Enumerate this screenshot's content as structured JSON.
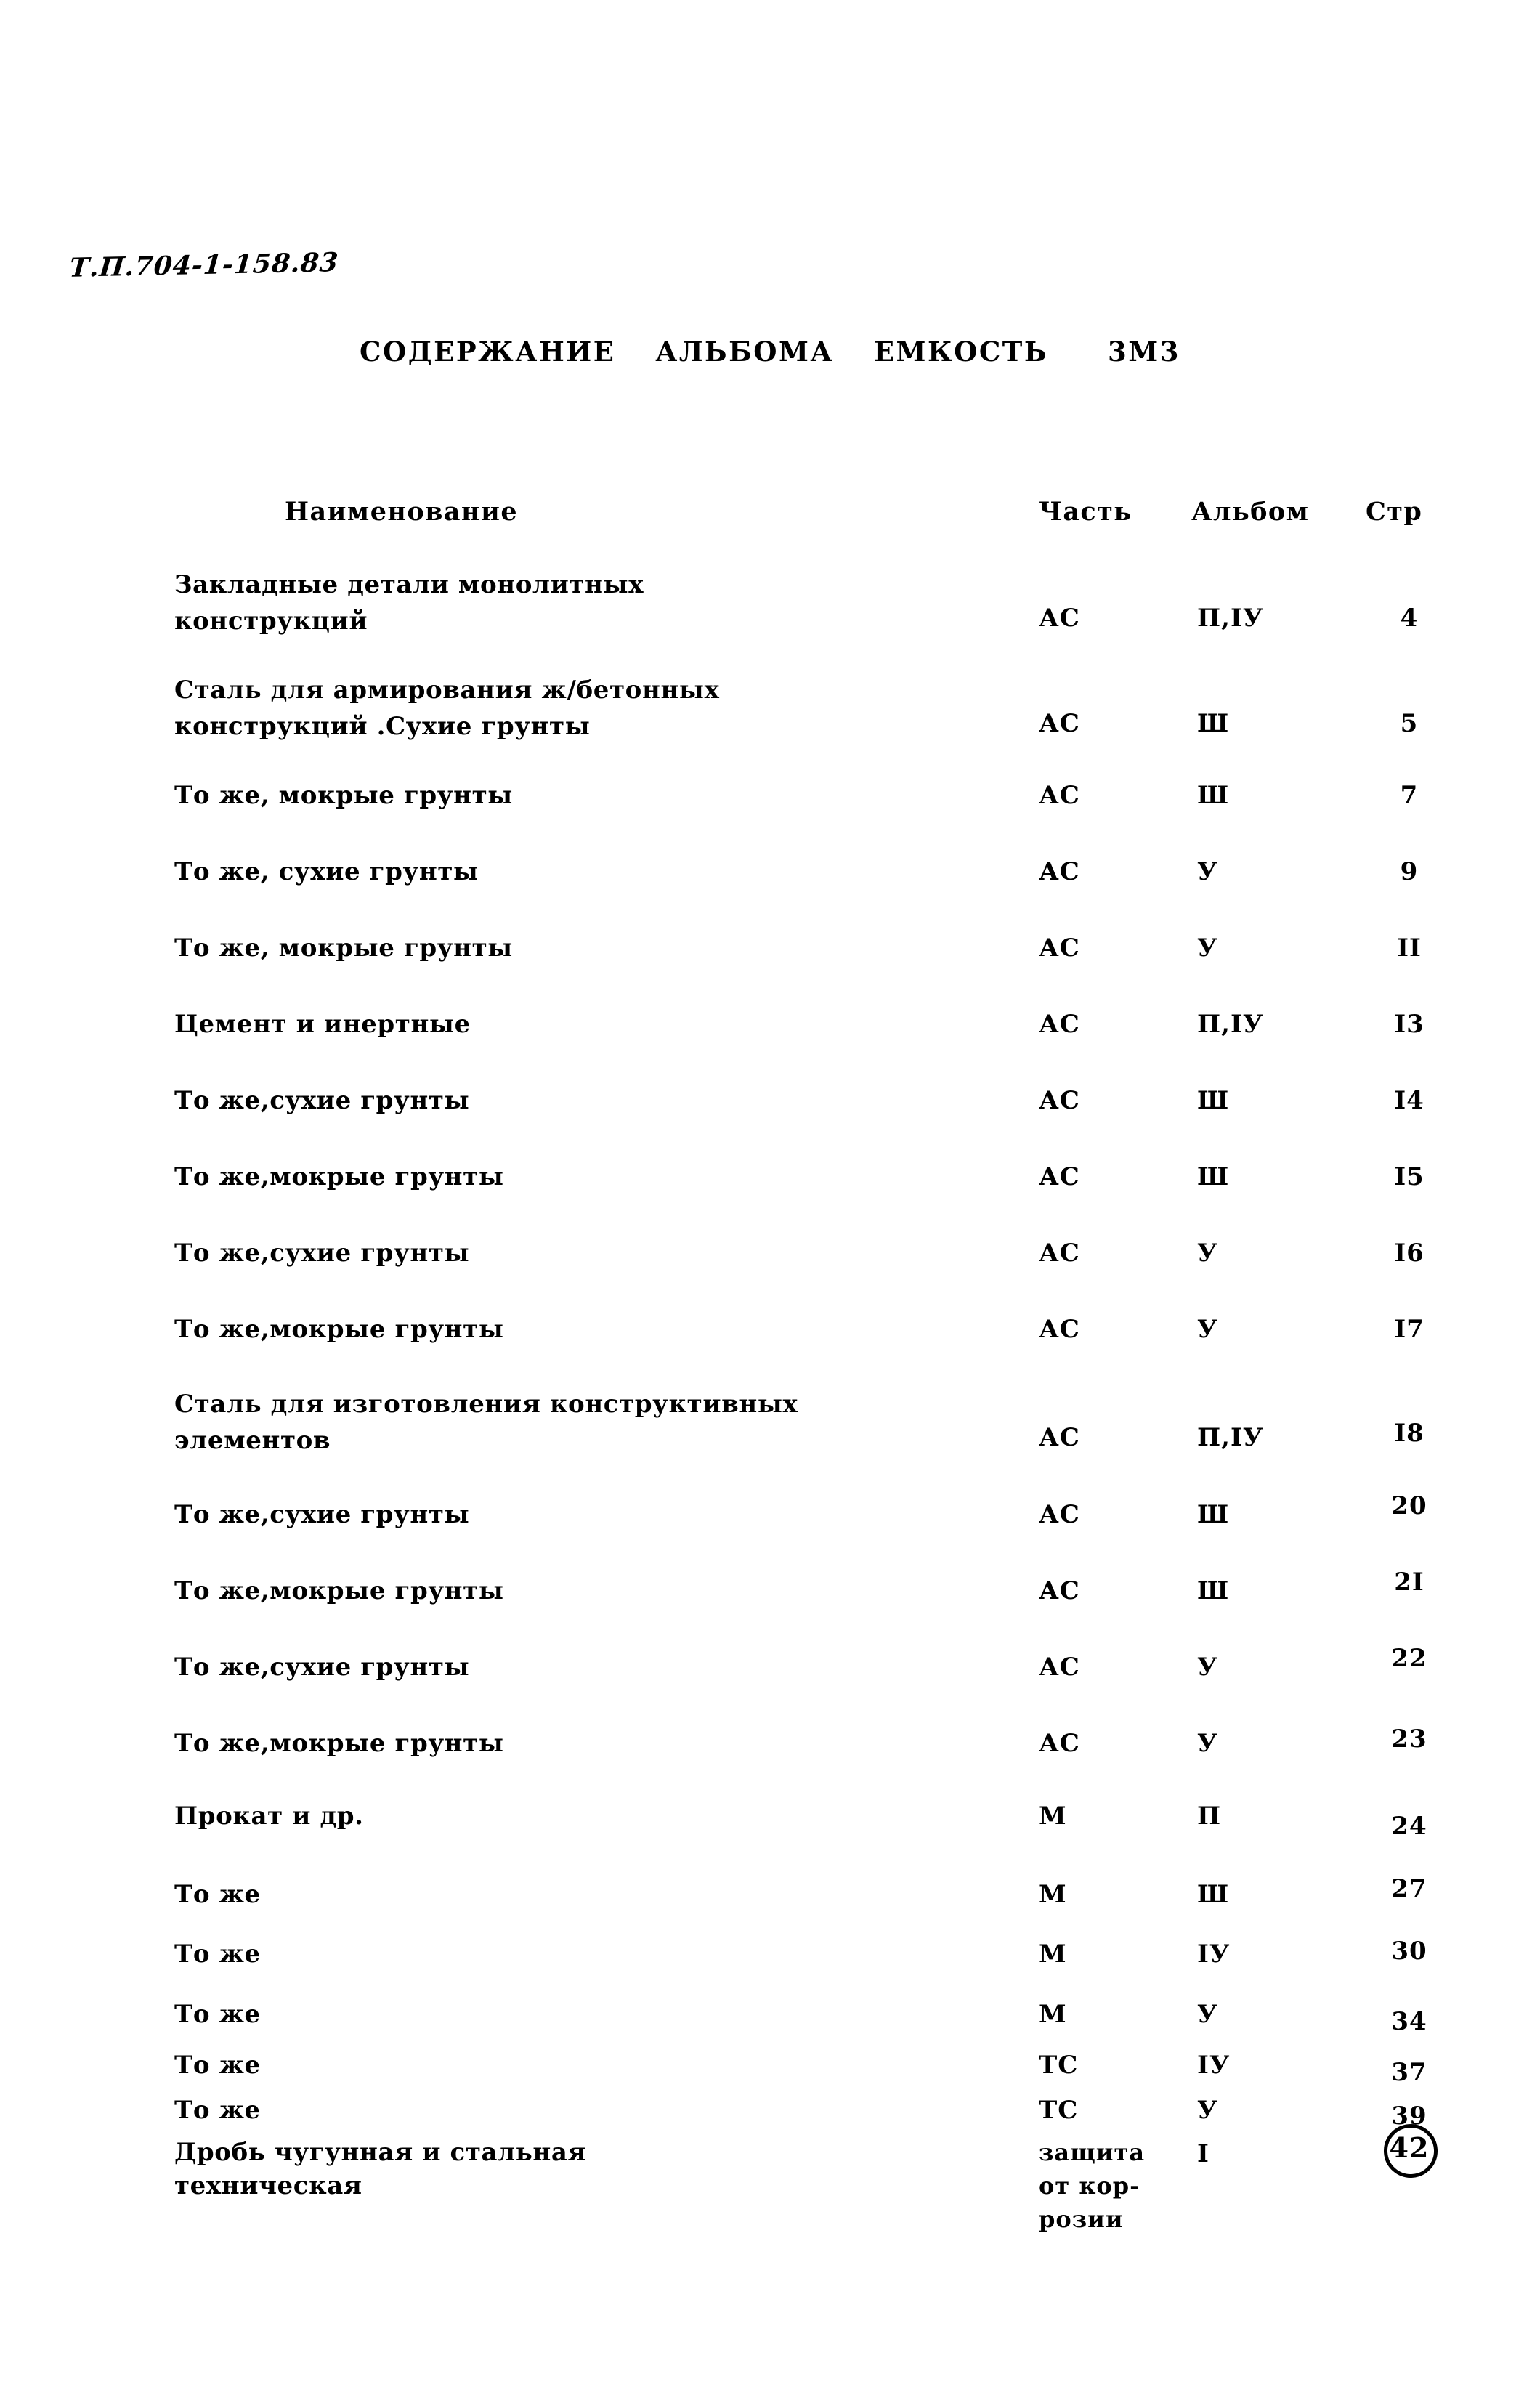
{
  "document": {
    "code": "Т.П.704-1-158.83",
    "title": "СОДЕРЖАНИЕ  АЛЬБОМА  ЕМКОСТЬ   3М3"
  },
  "table": {
    "headers": {
      "name": "Наименование",
      "part": "Часть",
      "album": "Альбом",
      "page": "Стр"
    },
    "rows": [
      {
        "name": "Закладные детали монолитных\nконструкций",
        "part": "АС",
        "album": "П,ІУ",
        "page": "4"
      },
      {
        "name": "Сталь для  армирования ж/бетонных\nконструкций .Сухие грунты",
        "part": "АС",
        "album": "Ш",
        "page": "5"
      },
      {
        "name": "То же, мокрые грунты",
        "part": "АС",
        "album": "Ш",
        "page": "7"
      },
      {
        "name": "То же, сухие грунты",
        "part": "АС",
        "album": "У",
        "page": "9"
      },
      {
        "name": "То же, мокрые грунты",
        "part": "АС",
        "album": "У",
        "page": "II"
      },
      {
        "name": "Цемент и инертные",
        "part": "АС",
        "album": "П,ІУ",
        "page": "I3"
      },
      {
        "name": "То же,сухие грунты",
        "part": "АС",
        "album": "Ш",
        "page": "I4"
      },
      {
        "name": "То же,мокрые грунты",
        "part": "АС",
        "album": "Ш",
        "page": "I5"
      },
      {
        "name": "То же,сухие грунты",
        "part": "АС",
        "album": "У",
        "page": "I6"
      },
      {
        "name": "То же,мокрые грунты",
        "part": "АС",
        "album": "У",
        "page": "I7"
      },
      {
        "name": "Сталь для изготовления конструктивных\nэлементов",
        "part": "АС",
        "album": "П,ІУ",
        "page": "I8"
      },
      {
        "name": "То же,сухие грунты",
        "part": "АС",
        "album": "Ш",
        "page": "20"
      },
      {
        "name": "То же,мокрые грунты",
        "part": "АС",
        "album": "Ш",
        "page": "2I"
      },
      {
        "name": "То же,сухие грунты",
        "part": "АС",
        "album": "У",
        "page": "22"
      },
      {
        "name": "То же,мокрые грунты",
        "part": "АС",
        "album": "У",
        "page": "23"
      },
      {
        "name": "Прокат и др.",
        "part": "М",
        "album": "П",
        "page": "24"
      },
      {
        "name": "То же",
        "part": "М",
        "album": "Ш",
        "page": "27"
      },
      {
        "name": "То же",
        "part": "М",
        "album": "ІУ",
        "page": "30"
      },
      {
        "name": "То же",
        "part": "М",
        "album": "У",
        "page": "34"
      },
      {
        "name": "То же",
        "part": "ТС",
        "album": "ІУ",
        "page": "37"
      },
      {
        "name": "То же",
        "part": "ТС",
        "album": "У",
        "page": "39"
      },
      {
        "name": "Дробь чугунная и стальная\nтехническая",
        "part": "защита\nот кор-\nрозии",
        "album": "I",
        "page": "42"
      }
    ]
  }
}
